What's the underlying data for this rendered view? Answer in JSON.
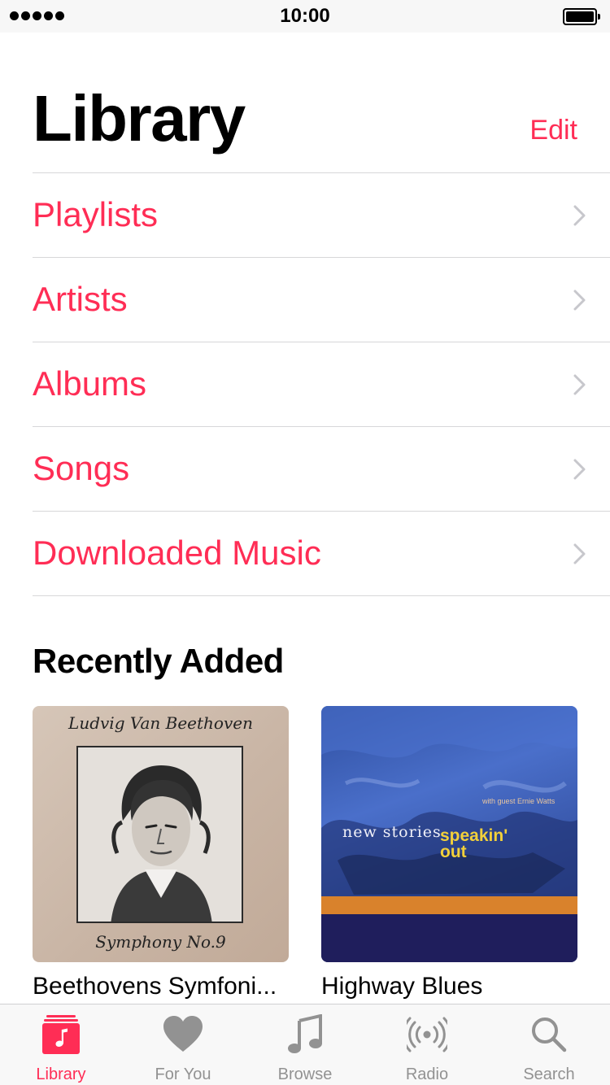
{
  "status_bar": {
    "time": "10:00"
  },
  "header": {
    "title": "Library",
    "edit_label": "Edit"
  },
  "menu": {
    "items": [
      {
        "label": "Playlists"
      },
      {
        "label": "Artists"
      },
      {
        "label": "Albums"
      },
      {
        "label": "Songs"
      },
      {
        "label": "Downloaded Music"
      }
    ]
  },
  "recently_added": {
    "title": "Recently Added",
    "albums": [
      {
        "title": "Beethovens Symfoni...",
        "cover_text_top": "Ludvig Van Beethoven",
        "cover_text_bottom": "Symphony No.9"
      },
      {
        "title": "Highway Blues",
        "cover_title": "new stories",
        "cover_subtitle": "speakin' out",
        "cover_credit": "with guest Ernie Watts"
      }
    ]
  },
  "tab_bar": {
    "tabs": [
      {
        "label": "Library",
        "icon": "library-icon",
        "active": true
      },
      {
        "label": "For You",
        "icon": "heart-icon",
        "active": false
      },
      {
        "label": "Browse",
        "icon": "music-note-icon",
        "active": false
      },
      {
        "label": "Radio",
        "icon": "radio-icon",
        "active": false
      },
      {
        "label": "Search",
        "icon": "search-icon",
        "active": false
      }
    ]
  },
  "colors": {
    "accent": "#ff2d55",
    "tab_inactive": "#929292",
    "separator": "#d7d7d9"
  }
}
